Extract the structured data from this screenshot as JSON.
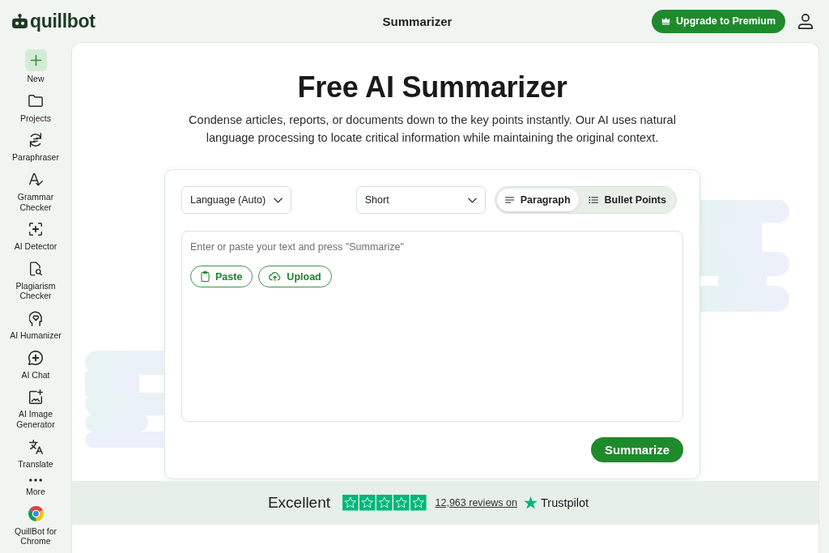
{
  "header": {
    "logo_text": "quillbot",
    "title": "Summarizer",
    "upgrade_button": "Upgrade to Premium"
  },
  "sidebar": {
    "items": [
      {
        "label": "New",
        "kind": "new"
      },
      {
        "label": "Projects",
        "kind": "tool"
      },
      {
        "label": "Paraphraser",
        "kind": "tool"
      },
      {
        "label": "Grammar Checker",
        "kind": "tool"
      },
      {
        "label": "AI Detector",
        "kind": "tool"
      },
      {
        "label": "Plagiarism Checker",
        "kind": "tool"
      },
      {
        "label": "AI Humanizer",
        "kind": "tool"
      },
      {
        "label": "AI Chat",
        "kind": "tool"
      },
      {
        "label": "AI Image Generator",
        "kind": "tool"
      },
      {
        "label": "Translate",
        "kind": "tool"
      },
      {
        "label": "More",
        "kind": "more"
      },
      {
        "label": "QuillBot for Chrome",
        "kind": "extension"
      }
    ]
  },
  "hero": {
    "title": "Free AI Summarizer",
    "description": "Condense articles, reports, or documents down to the key points instantly. Our AI uses natural language processing to locate critical information while maintaining the original context."
  },
  "summarizer": {
    "language_dropdown": "Language (Auto)",
    "length_dropdown": "Short",
    "modes": [
      {
        "label": "Paragraph",
        "selected": true
      },
      {
        "label": "Bullet Points",
        "selected": false
      }
    ],
    "input": {
      "placeholder": "Enter or paste your text and press \"Summarize\""
    },
    "paste_button": "Paste",
    "upload_button": "Upload",
    "summarize_button": "Summarize"
  },
  "trustpilot": {
    "rating_label": "Excellent",
    "stars": 5,
    "reviews_link": "12,963 reviews on",
    "brand": "Trustpilot"
  }
}
